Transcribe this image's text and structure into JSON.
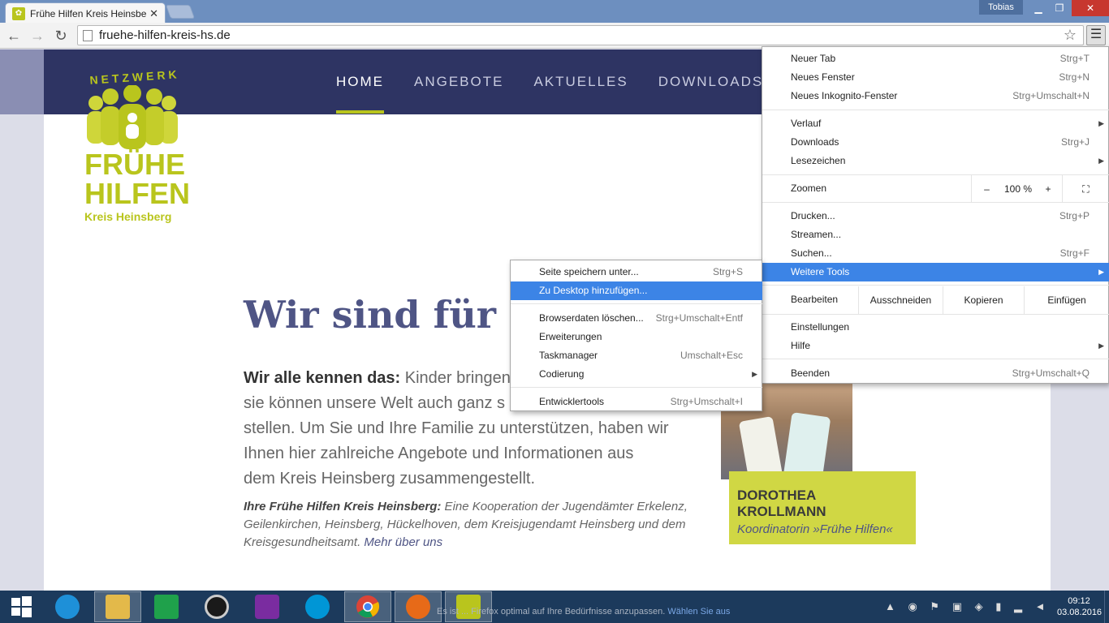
{
  "browser": {
    "tab_title": "Frühe Hilfen Kreis Heinsbe",
    "tab_close": "✕",
    "user": "Tobias",
    "url": "fruehe-hilfen-kreis-hs.de",
    "window_controls": {
      "minimize": "▁",
      "maximize": "❐",
      "close": "✕"
    }
  },
  "site": {
    "logo": {
      "netzwerk": "NETZWERK",
      "line1": "FRÜHE",
      "line2": "HILFEN",
      "sub": "Kreis Heinsberg"
    },
    "nav": [
      "HOME",
      "ANGEBOTE",
      "AKTUELLES",
      "DOWNLOADS"
    ],
    "headline": "Wir sind für Si",
    "intro_bold": "Wir alle kennen das:",
    "intro_line1": " Kinder bringen",
    "intro_line2": "sie können unsere Welt auch ganz s",
    "intro_line3": "stellen. Um Sie und Ihre Familie zu unterstützen, haben wir",
    "intro_line4": "Ihnen hier zahlreiche Angebote und Informationen aus",
    "intro_line5": "dem Kreis Heinsberg zusammengestellt.",
    "coop_bold": "Ihre Frühe Hilfen Kreis Heinsberg:",
    "coop_text": " Eine Kooperation der Jugendämter Erkelenz, Geilenkirchen, Heinsberg, Hückelhoven, dem Kreisjugendamt Heinsberg und dem Kreisgesundheitsamt.",
    "coop_link": "Mehr über uns",
    "caption_name": "DOROTHEA KROLLMANN",
    "caption_role": "Koordinatorin »Frühe Hilfen«"
  },
  "menu": {
    "items": [
      {
        "label": "Neuer Tab",
        "shortcut": "Strg+T"
      },
      {
        "label": "Neues Fenster",
        "shortcut": "Strg+N"
      },
      {
        "label": "Neues Inkognito-Fenster",
        "shortcut": "Strg+Umschalt+N"
      },
      {
        "label": "Verlauf",
        "shortcut": ""
      },
      {
        "label": "Downloads",
        "shortcut": "Strg+J"
      },
      {
        "label": "Lesezeichen",
        "shortcut": ""
      },
      {
        "label": "Drucken...",
        "shortcut": "Strg+P"
      },
      {
        "label": "Streamen...",
        "shortcut": ""
      },
      {
        "label": "Suchen...",
        "shortcut": "Strg+F"
      },
      {
        "label": "Weitere Tools",
        "shortcut": ""
      },
      {
        "label": "Einstellungen",
        "shortcut": ""
      },
      {
        "label": "Hilfe",
        "shortcut": ""
      },
      {
        "label": "Beenden",
        "shortcut": "Strg+Umschalt+Q"
      }
    ],
    "zoom": {
      "label": "Zoomen",
      "minus": "–",
      "value": "100 %",
      "plus": "+",
      "fullscreen": "⛶"
    },
    "edit": {
      "label": "Bearbeiten",
      "cut": "Ausschneiden",
      "copy": "Kopieren",
      "paste": "Einfügen"
    },
    "arrow": "▶"
  },
  "submenu": {
    "items": [
      {
        "label": "Seite speichern unter...",
        "shortcut": "Strg+S"
      },
      {
        "label": "Zu Desktop hinzufügen...",
        "shortcut": ""
      },
      {
        "label": "Browserdaten löschen...",
        "shortcut": "Strg+Umschalt+Entf"
      },
      {
        "label": "Erweiterungen",
        "shortcut": ""
      },
      {
        "label": "Taskmanager",
        "shortcut": "Umschalt+Esc"
      },
      {
        "label": "Codierung",
        "shortcut": ""
      },
      {
        "label": "Entwicklertools",
        "shortcut": "Strg+Umschalt+I"
      }
    ]
  },
  "taskbar": {
    "notice": "Es ist ... Firefox optimal auf Ihre Bedürfnisse anzupassen.",
    "notice_link": "Wählen Sie aus",
    "time": "09:12",
    "date": "03.08.2016",
    "colors": {
      "ie": "#1e90d8",
      "explorer": "#e3b94a",
      "store": "#1fa14b",
      "camera": "#1a1a1a",
      "app": "#7a2ca0",
      "hp": "#0096d6",
      "chrome": "#ffffff",
      "firefox": "#e76a18",
      "fruehe": "#b9c51d"
    }
  }
}
